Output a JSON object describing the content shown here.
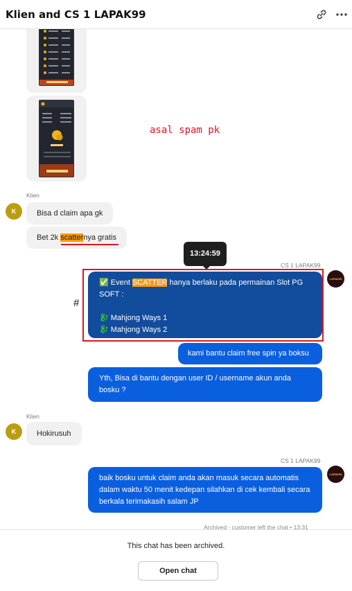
{
  "header": {
    "title": "Klien and CS 1 LAPAK99"
  },
  "annotations": {
    "spam_note": "asal spam pk",
    "hash_mark": "#"
  },
  "tooltip": {
    "time": "13:24:59"
  },
  "messages": {
    "sender_client": "Klien",
    "sender_agent": "CS 1 LAPAK99",
    "m1": "Bisa d claim apa gk",
    "m2": {
      "pre": "Bet 2k ",
      "highlight": "scatter",
      "post": "nya gratis"
    },
    "m3": {
      "check": "✅",
      "pre": " Event ",
      "highlight": "SCATTER",
      "post": " hanya berlaku pada permainan Slot PG SOFT :",
      "item1": "Mahjong Ways 1",
      "item2": "Mahjong Ways 2",
      "bullet": "🐉"
    },
    "m4": "kami bantu claim free spin ya boksu",
    "m5": "Yth, Bisa di bantu dengan user ID / username akun anda bosku ?",
    "m6": "Hokirusuh",
    "m7": "baik bosku untuk claim anda akan masuk secara automatis dalam waktu 50 menit kedepan silahkan di cek kembali secara berkala terimakasih salam JP"
  },
  "avatars": {
    "client_initial": "K",
    "agent_logo": "LAPAK99"
  },
  "status": {
    "archived_line": "Archived - customer left the chat • 13:31"
  },
  "footer": {
    "archived_text": "This chat has been archived.",
    "open_button": "Open chat"
  },
  "colors": {
    "agent_bubble": "#0a5fde",
    "highlighted_bubble": "#124c9c",
    "annotation_red": "#e0141e",
    "highlight": "#f59a14",
    "client_avatar": "#bb9e10"
  },
  "icons": {
    "link": "link-icon",
    "more": "more-icon"
  }
}
